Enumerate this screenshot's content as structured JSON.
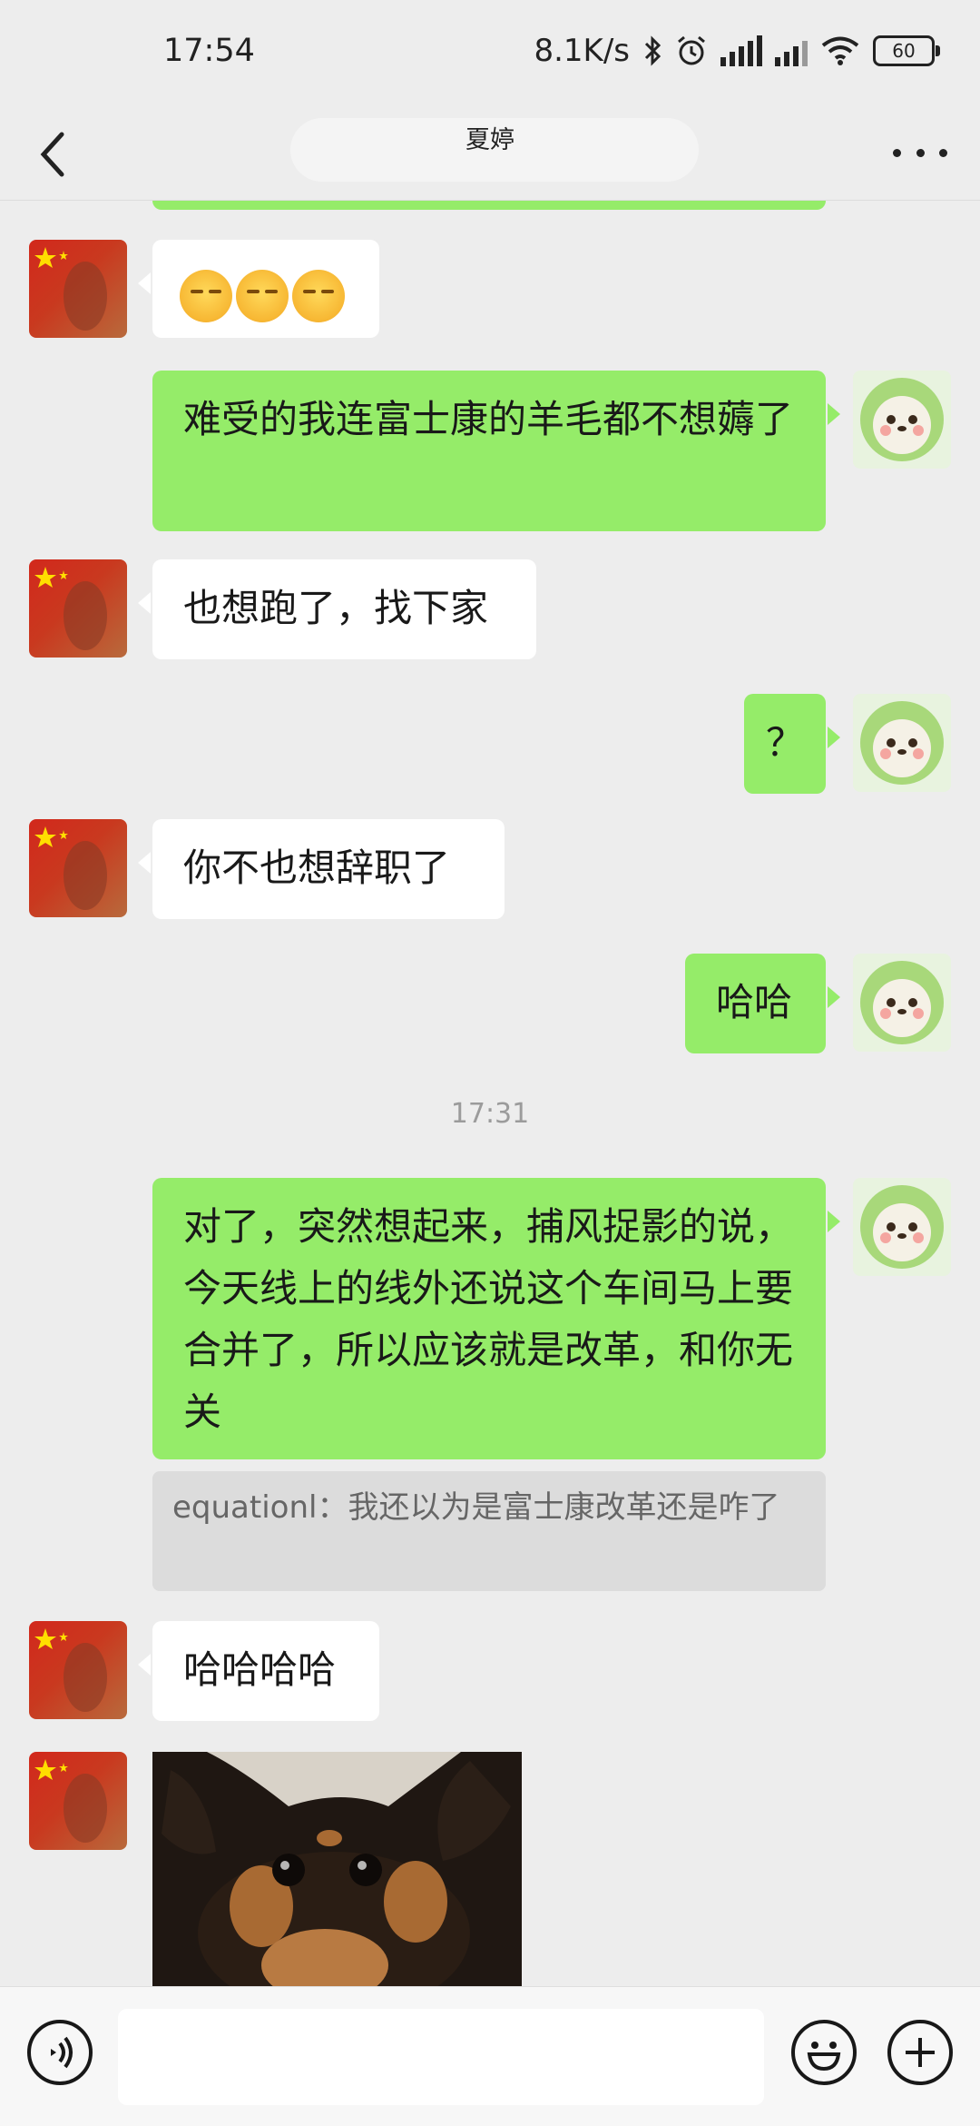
{
  "status_bar": {
    "time": "17:54",
    "network_speed": "8.1K/s",
    "battery": "60",
    "icons": [
      "bluetooth-icon",
      "alarm-icon",
      "signal-icon",
      "hd-signal-icon",
      "wifi-icon",
      "battery-icon"
    ]
  },
  "header": {
    "title": "夏婷",
    "back_icon": "chevron-left-icon",
    "more_icon": "more-dots-icon"
  },
  "messages": [
    {
      "side": "left",
      "type": "emoji",
      "emoji_count": 3,
      "emoji_name": "loudly-crying-face"
    },
    {
      "side": "right",
      "type": "text",
      "text": "难受的我连富士康的羊毛都不想薅了"
    },
    {
      "side": "left",
      "type": "text",
      "text": "也想跑了，找下家"
    },
    {
      "side": "right",
      "type": "text",
      "text": "？"
    },
    {
      "side": "left",
      "type": "text",
      "text": "你不也想辞职了"
    },
    {
      "side": "right",
      "type": "text",
      "text": "哈哈"
    },
    {
      "type": "timestamp",
      "text": "17:31"
    },
    {
      "side": "right",
      "type": "text",
      "text": "对了，突然想起来，捕风捉影的说，今天线上的线外还说这个车间马上要合并了，所以应该就是改革，和你无关",
      "quote": "equationl：我还以为是富士康改革还是咋了"
    },
    {
      "side": "left",
      "type": "text",
      "text": "哈哈哈哈"
    },
    {
      "side": "left",
      "type": "image",
      "description": "dog-photo"
    }
  ],
  "input_bar": {
    "voice_icon": "voice-icon",
    "emoji_icon": "emoji-icon",
    "plus_icon": "plus-icon"
  },
  "colors": {
    "bubble_self": "#95ec69",
    "bubble_other": "#ffffff",
    "background": "#ededed"
  }
}
